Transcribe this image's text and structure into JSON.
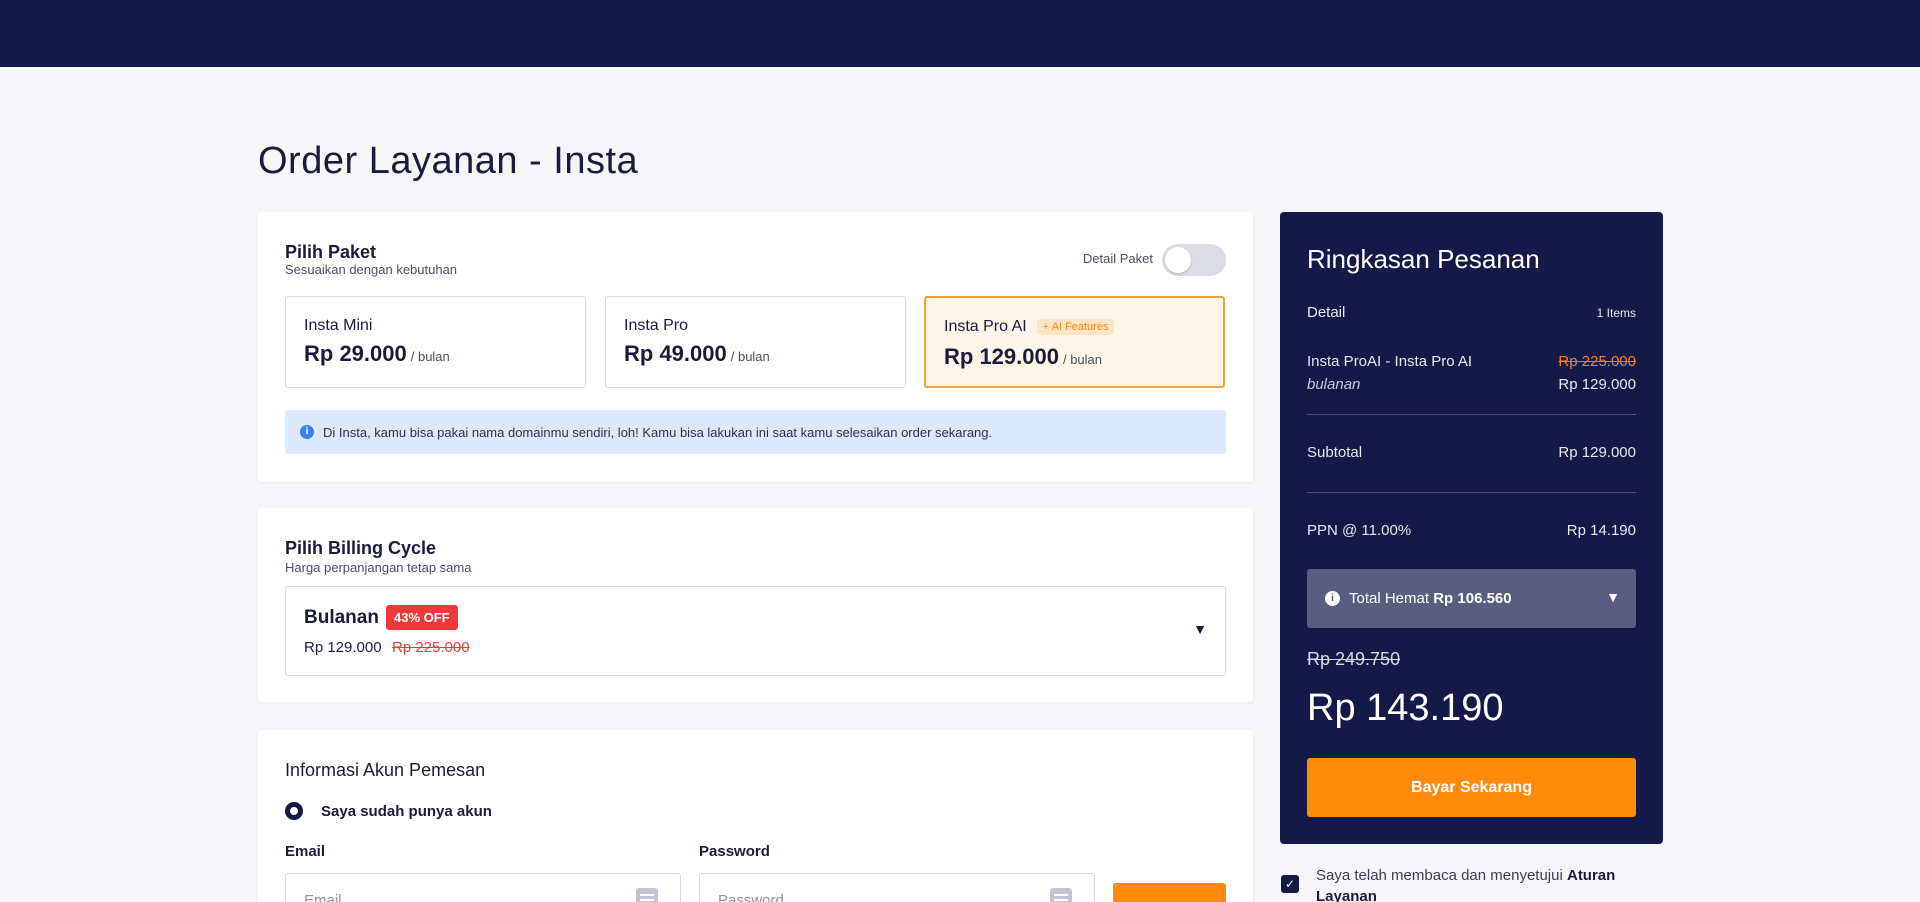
{
  "page": {
    "title": "Order Layanan - Insta"
  },
  "paket": {
    "title": "Pilih Paket",
    "subtitle": "Sesuaikan dengan kebutuhan",
    "detail_toggle_label": "Detail Paket",
    "plans": [
      {
        "name": "Insta Mini",
        "price": "Rp 29.000",
        "unit": "/ bulan",
        "badge": ""
      },
      {
        "name": "Insta Pro",
        "price": "Rp 49.000",
        "unit": "/ bulan",
        "badge": ""
      },
      {
        "name": "Insta Pro AI",
        "price": "Rp 129.000",
        "unit": "/ bulan",
        "badge": "+ AI Features"
      }
    ],
    "info": "Di Insta, kamu bisa pakai nama domainmu sendiri, loh! Kamu bisa lakukan ini saat kamu selesaikan order sekarang."
  },
  "billing": {
    "title": "Pilih Billing Cycle",
    "subtitle": "Harga perpanjangan tetap sama",
    "selected": "Bulanan",
    "discount_badge": "43% OFF",
    "price": "Rp 129.000",
    "old_price": "Rp 225.000"
  },
  "akun": {
    "title": "Informasi Akun Pemesan",
    "radio_label": "Saya sudah punya akun",
    "email_label": "Email",
    "email_placeholder": "Email",
    "password_label": "Password",
    "password_placeholder": "Password"
  },
  "summary": {
    "title": "Ringkasan Pesanan",
    "detail_label": "Detail",
    "items_count": "1 Items",
    "item_name": "Insta ProAI - Insta Pro AI",
    "item_period": "bulanan",
    "item_old_price": "Rp 225.000",
    "item_price": "Rp 129.000",
    "subtotal_label": "Subtotal",
    "subtotal": "Rp 129.000",
    "ppn_label": "PPN @ 11.00%",
    "ppn": "Rp 14.190",
    "hemat_label": "Total Hemat",
    "hemat_value": "Rp 106.560",
    "old_total": "Rp 249.750",
    "total": "Rp 143.190",
    "pay_button": "Bayar Sekarang"
  },
  "agreement": {
    "text": "Saya telah membaca dan menyetujui",
    "link": "Aturan Layanan"
  },
  "colors": {
    "navy": "#141a47",
    "orange": "#ff8a0c",
    "red": "#ec3a3a",
    "info_bg": "#dbe9fd"
  }
}
